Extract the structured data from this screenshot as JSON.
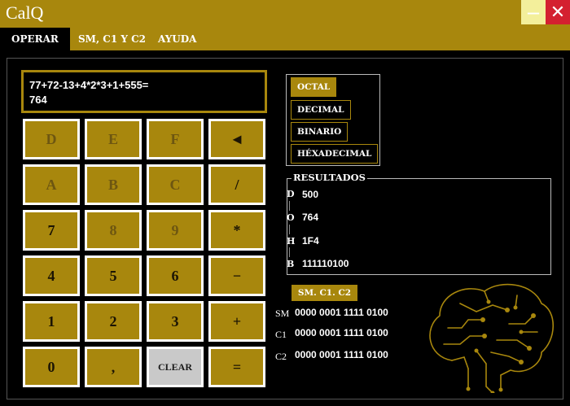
{
  "app": {
    "title": "CalQ"
  },
  "window": {
    "minimize_glyph": "—",
    "close_glyph": "✕"
  },
  "menu": {
    "items": [
      "OPERAR",
      "SM, C1 Y C2",
      "AYUDA"
    ]
  },
  "display": {
    "expression": "77+72-13+4*2*3+1+555=",
    "result": "764"
  },
  "keys": [
    "D",
    "E",
    "F",
    "◄",
    "A",
    "B",
    "C",
    "/",
    "7",
    "8",
    "9",
    "*",
    "4",
    "5",
    "6",
    "−",
    "1",
    "2",
    "3",
    "+",
    "0",
    ",",
    "CLEAR",
    "="
  ],
  "bases": {
    "items": [
      "OCTAL",
      "DECIMAL",
      "BINARIO",
      "HÉXADECIMAL"
    ],
    "selected": "OCTAL"
  },
  "results": {
    "title": "RESULTADOS",
    "rows": [
      {
        "label": "D",
        "value": "500"
      },
      {
        "label": "O",
        "value": "764"
      },
      {
        "label": "H",
        "value": "1F4"
      },
      {
        "label": "B",
        "value": "111110100"
      }
    ]
  },
  "sm": {
    "title": "SM. C1. C2",
    "rows": [
      {
        "label": "SM",
        "value": "0000 0001 1111 0100"
      },
      {
        "label": "C1",
        "value": "0000 0001 1111 0100"
      },
      {
        "label": "C2",
        "value": "0000 0001 1111 0100"
      }
    ]
  },
  "colors": {
    "accent": "#a8870d",
    "background": "#000000",
    "close": "#d42030",
    "minimize": "#f3ef9b",
    "clear_key": "#c9c9c9"
  },
  "icons": {
    "brain": "brain-circuit-icon"
  }
}
